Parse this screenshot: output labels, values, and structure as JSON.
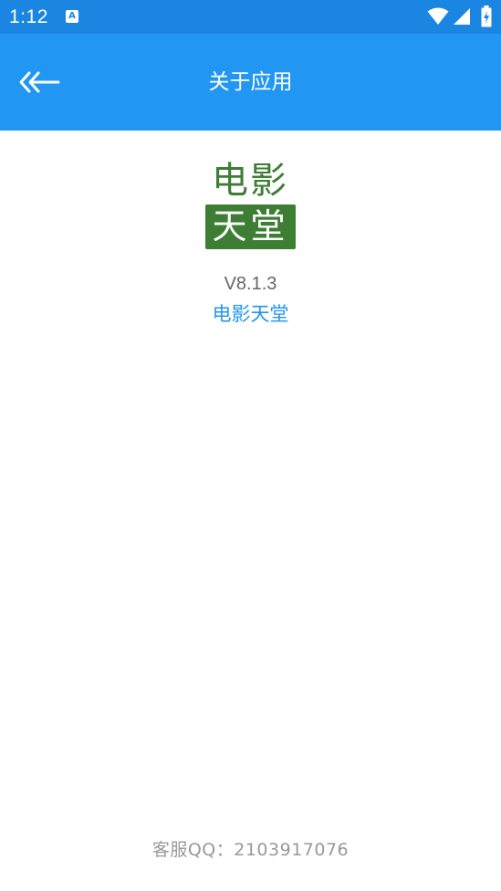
{
  "status_bar": {
    "time": "1:12",
    "notification_icon_letter": "A",
    "icons": [
      "notification-icon",
      "wifi-icon",
      "signal-icon",
      "battery-charging-icon"
    ],
    "color": "#1b86e1"
  },
  "app_bar": {
    "title": "关于应用",
    "back_icon": "back-arrow-icon",
    "color": "#2196f3"
  },
  "logo": {
    "line1": "电影",
    "line2": "天堂",
    "color": "#3e7e34"
  },
  "about": {
    "version": "V8.1.3",
    "app_name": "电影天堂",
    "link_color": "#2196f3"
  },
  "footer": {
    "support": "客服QQ：2103917076"
  }
}
